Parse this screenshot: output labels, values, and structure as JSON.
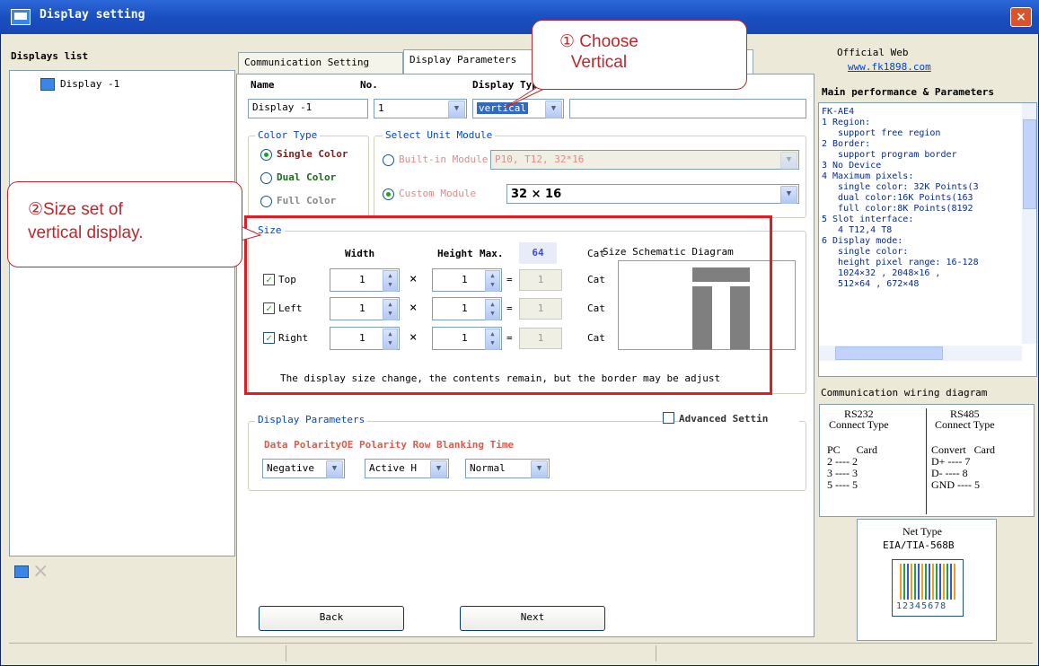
{
  "window": {
    "title": "Display setting",
    "close": "×"
  },
  "left": {
    "header": "Displays list",
    "items": [
      "Display -1"
    ],
    "add_icon": "display-add-icon",
    "delete_icon": "×"
  },
  "tabs": [
    "Communication Setting",
    "Display Parameters"
  ],
  "form": {
    "name_label": "Name",
    "name_value": "Display -1",
    "no_label": "No.",
    "no_value": "1",
    "type_label": "Display Type",
    "type_value": "vertical",
    "extra_value": ""
  },
  "color_type": {
    "title": "Color Type",
    "options": [
      "Single Color",
      "Dual Color",
      "Full Color"
    ]
  },
  "unit_module": {
    "title": "Select Unit Module",
    "builtin_label": "Built-in Module",
    "builtin_value": "P10, T12, 32*16",
    "custom_label": "Custom Module",
    "custom_value": "32 × 16"
  },
  "size": {
    "title": "Size",
    "width_header": "Width",
    "height_header": "Height",
    "max_label": "Max.",
    "max_value": "64",
    "cat_header": "Cat",
    "rows": [
      {
        "label": "Top",
        "width": "1",
        "height": "1",
        "op": "=",
        "result": "1",
        "unit": "Cat"
      },
      {
        "label": "Left",
        "width": "1",
        "height": "1",
        "op": "=",
        "result": "1",
        "unit": "Cat"
      },
      {
        "label": "Right",
        "width": "1",
        "height": "1",
        "op": "=",
        "result": "1",
        "unit": "Cat"
      }
    ],
    "times": "×",
    "diagram_title": "Size Schematic Diagram",
    "note": "The display size change, the contents remain, but the border may be adjust"
  },
  "display_params": {
    "title": "Display Parameters",
    "advanced": "Advanced Settin",
    "headers": "Data PolarityOE Polarity Row Blanking Time",
    "data_polarity": "Negative",
    "oe_polarity": "Active H",
    "row_blanking": "Normal"
  },
  "buttons": {
    "back": "Back",
    "next": "Next"
  },
  "right": {
    "official_label": "Official Web",
    "official_url": "www.fk1898.com",
    "perf_title": "Main performance & Parameters",
    "perf_text": "FK-AE4\n1 Region:\n   support free region\n2 Border:\n   support program border\n3 No Device\n4 Maximum pixels:\n   single color: 32K Points(3\n   dual color:16K Points(163\n   full color:8K Points(8192\n5 Slot interface:\n   4 T12,4 T8\n6 Display mode:\n   single color:\n   height pixel range: 16-128\n   1024×32 , 2048×16 ,\n   512×64 , 672×48",
    "wiring_title": "Communication wiring diagram",
    "rs232": "RS232\nConnect Type",
    "rs485": "RS485\nConnect Type",
    "rs232_pins": "PC      Card\n2 ---- 2\n3 ---- 3\n5 ---- 5",
    "rs485_pins": "Convert   Card\nD+ ---- 7\nD- ---- 8\nGND ---- 5",
    "net_type": "Net Type",
    "net_std": "EIA/TIA-568B",
    "net_pins": "12345678"
  },
  "callouts": {
    "c1": "① Choose\nVertical",
    "c2": "②Size set of\nvertical display."
  },
  "colors": {
    "accent": "#e31b23",
    "title_bar": "#1a4fc0"
  }
}
